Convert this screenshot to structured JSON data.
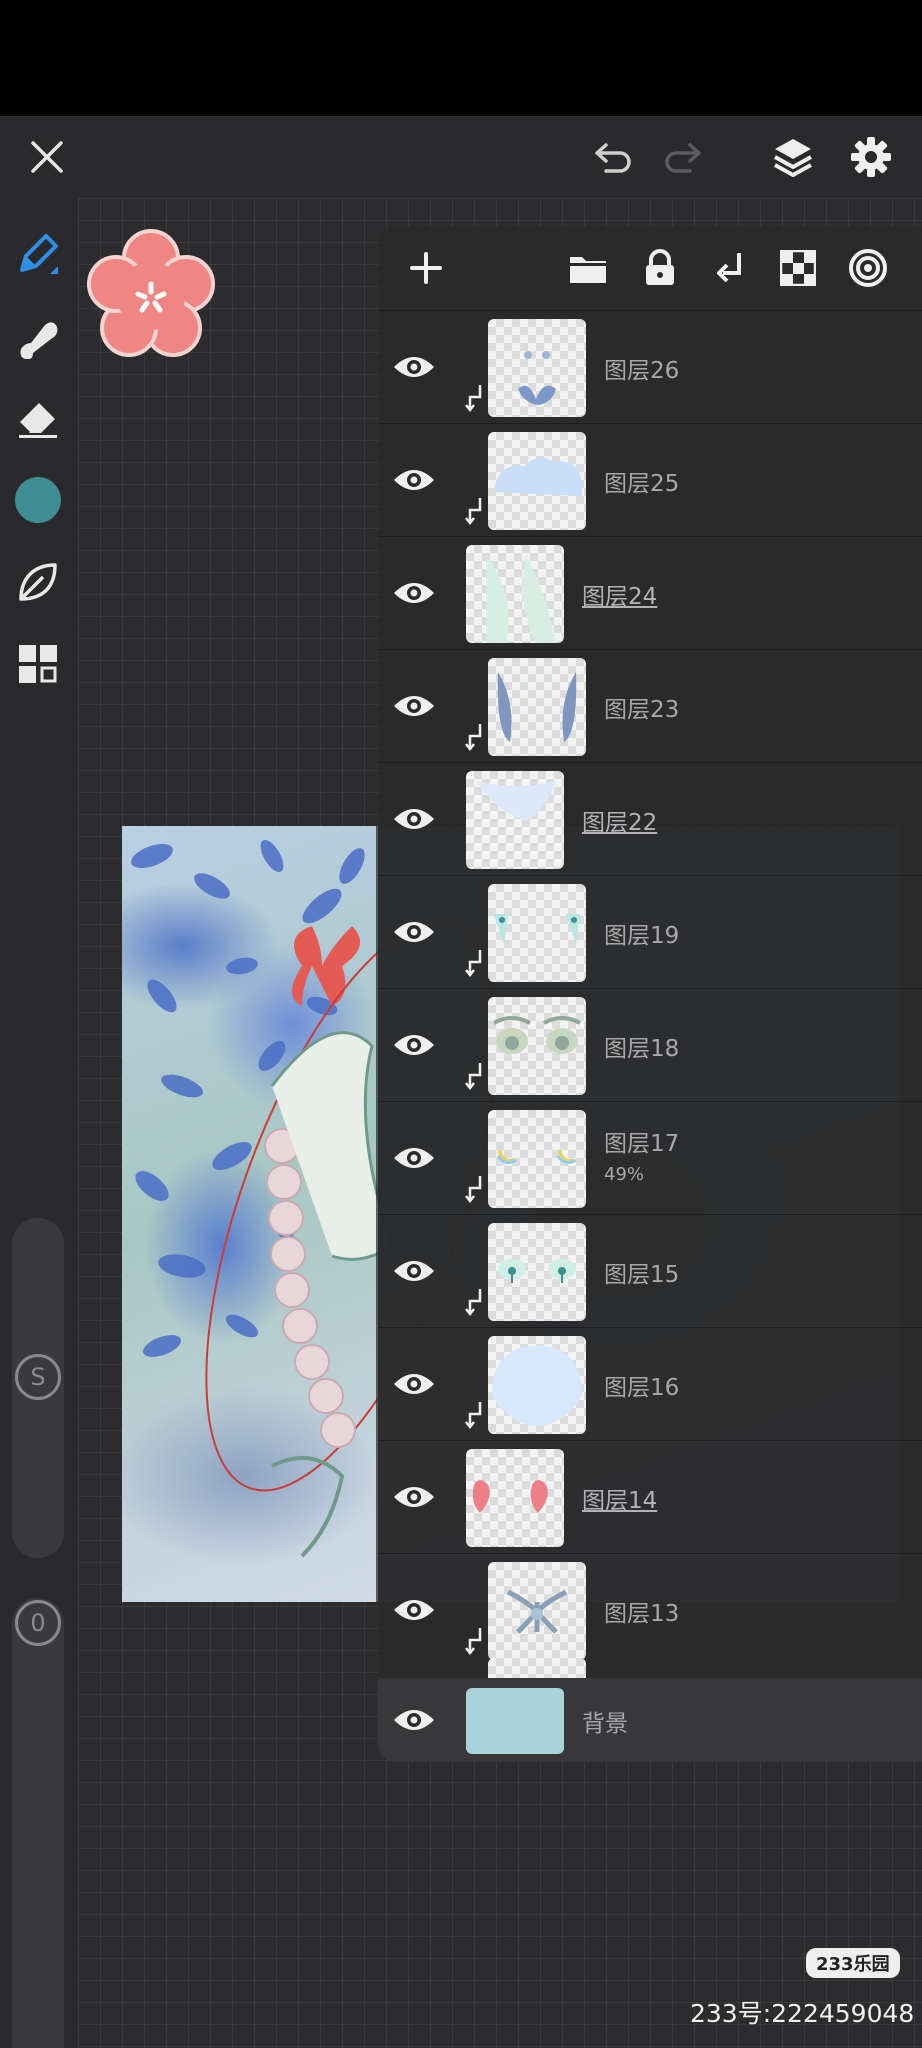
{
  "toolbar": {
    "close_icon": "close-icon",
    "undo_icon": "undo-icon",
    "redo_icon": "redo-icon",
    "layers_icon": "layers-icon",
    "settings_icon": "gear-icon"
  },
  "tools": {
    "active_color": "#3d8f93",
    "size_slider_label": "S",
    "opacity_slider_label": "0"
  },
  "layer_panel": {
    "layers": [
      {
        "name": "图层26",
        "clipped": true,
        "selected": false,
        "opacity": ""
      },
      {
        "name": "图层25",
        "clipped": true,
        "selected": false,
        "opacity": ""
      },
      {
        "name": "图层24",
        "clipped": false,
        "selected": true,
        "opacity": ""
      },
      {
        "name": "图层23",
        "clipped": true,
        "selected": false,
        "opacity": ""
      },
      {
        "name": "图层22",
        "clipped": false,
        "selected": true,
        "opacity": ""
      },
      {
        "name": "图层19",
        "clipped": true,
        "selected": false,
        "opacity": ""
      },
      {
        "name": "图层18",
        "clipped": true,
        "selected": false,
        "opacity": ""
      },
      {
        "name": "图层17",
        "clipped": true,
        "selected": false,
        "opacity": "49%"
      },
      {
        "name": "图层15",
        "clipped": true,
        "selected": false,
        "opacity": ""
      },
      {
        "name": "图层16",
        "clipped": true,
        "selected": false,
        "opacity": ""
      },
      {
        "name": "图层14",
        "clipped": false,
        "selected": true,
        "opacity": ""
      },
      {
        "name": "图层13",
        "clipped": true,
        "selected": false,
        "opacity": ""
      }
    ],
    "background": {
      "name": "背景",
      "color": "#a9d2da"
    }
  },
  "watermark": {
    "badge": "233乐园",
    "id_text": "233号:222459048"
  }
}
